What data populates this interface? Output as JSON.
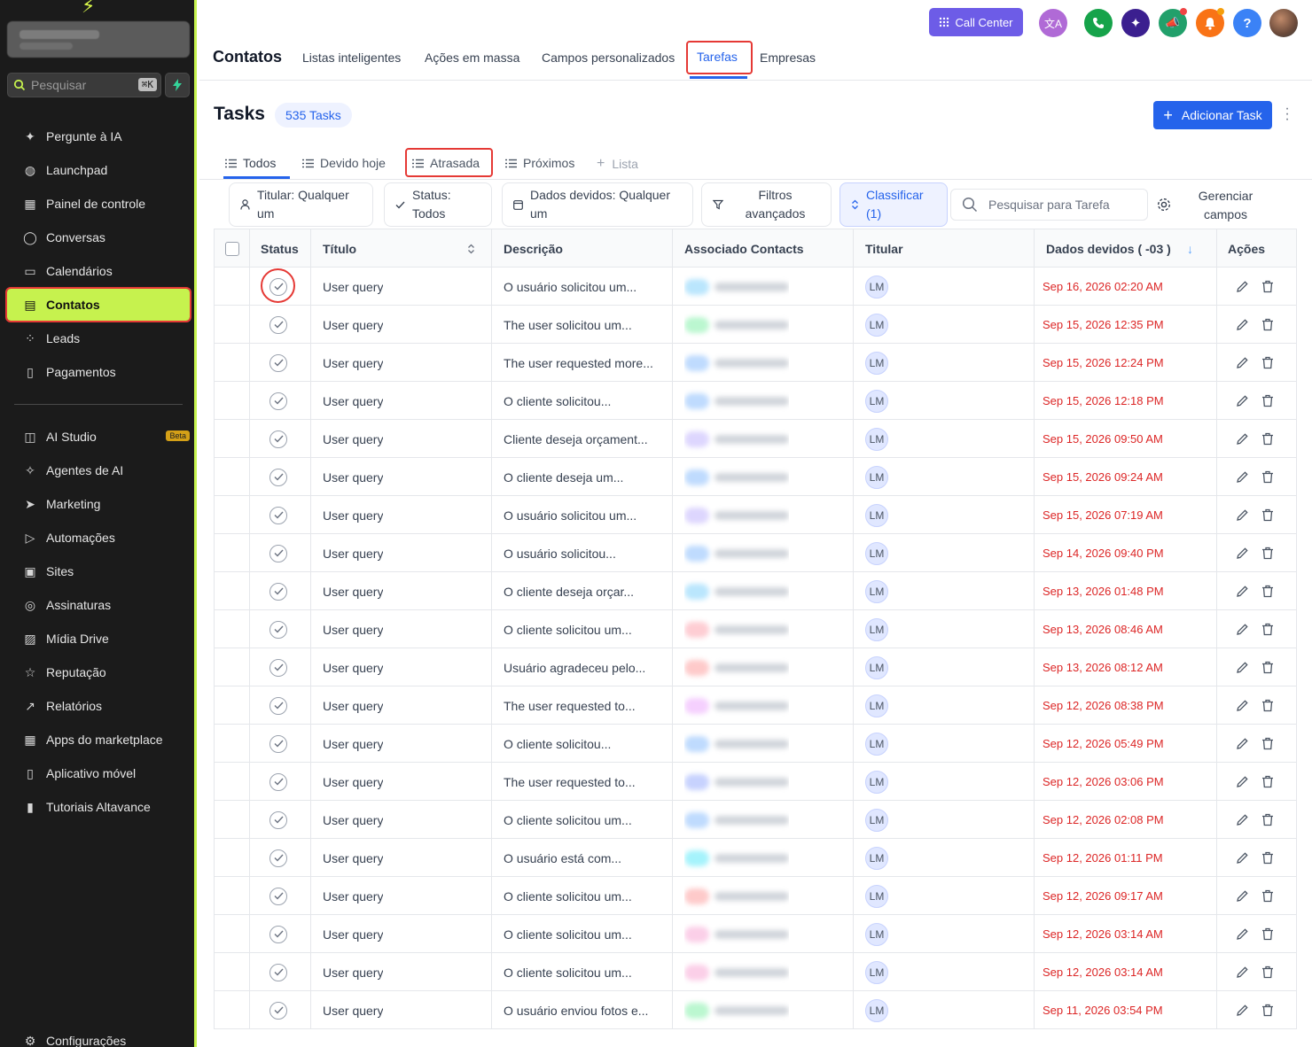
{
  "sidebar": {
    "search_placeholder": "Pesquisar",
    "search_shortcut": "⌘K",
    "items": [
      {
        "label": "Pergunte à IA",
        "icon": "sparkles-icon"
      },
      {
        "label": "Launchpad",
        "icon": "rocket-icon"
      },
      {
        "label": "Painel de controle",
        "icon": "dashboard-grid-icon"
      },
      {
        "label": "Conversas",
        "icon": "chat-bubble-icon"
      },
      {
        "label": "Calendários",
        "icon": "calendar-icon"
      },
      {
        "label": "Contatos",
        "icon": "contacts-card-icon",
        "active": true
      },
      {
        "label": "Leads",
        "icon": "leads-network-icon"
      },
      {
        "label": "Pagamentos",
        "icon": "receipt-icon"
      }
    ],
    "items2": [
      {
        "label": "AI Studio",
        "icon": "ai-studio-icon",
        "badge": "Beta"
      },
      {
        "label": "Agentes de AI",
        "icon": "ai-agent-icon"
      },
      {
        "label": "Marketing",
        "icon": "send-plane-icon"
      },
      {
        "label": "Automações",
        "icon": "automation-play-icon"
      },
      {
        "label": "Sites",
        "icon": "sites-window-icon"
      },
      {
        "label": "Assinaturas",
        "icon": "membership-badge-icon"
      },
      {
        "label": "Mídia Drive",
        "icon": "image-icon"
      },
      {
        "label": "Reputação",
        "icon": "star-icon"
      },
      {
        "label": "Relatórios",
        "icon": "trend-chart-icon"
      },
      {
        "label": "Apps do marketplace",
        "icon": "apps-grid-icon"
      },
      {
        "label": "Aplicativo móvel",
        "icon": "mobile-phone-icon"
      },
      {
        "label": "Tutoriais Altavance",
        "icon": "book-icon"
      }
    ],
    "settings_label": "Configurações"
  },
  "topbar": {
    "title": "Contatos",
    "tabs": [
      "Listas inteligentes",
      "Ações em massa",
      "Campos personalizados",
      "Tarefas",
      "Empresas"
    ],
    "active_tab": "Tarefas",
    "call_center_label": "Call Center"
  },
  "page": {
    "title": "Tasks",
    "count_label": "535 Tasks",
    "add_button": "Adicionar Task",
    "subtabs": [
      "Todos",
      "Devido hoje",
      "Atrasada",
      "Próximos",
      "Lista"
    ],
    "filters": {
      "owner_l1": "Titular: Qualquer",
      "owner_l2": "um",
      "status_l1": "Status:",
      "status_l2": "Todos",
      "due_l1": "Dados devidos: Qualquer",
      "due_l2": "um",
      "advanced_l1": "Filtros",
      "advanced_l2": "avançados",
      "sort_l1": "Classificar",
      "sort_l2": "(1)",
      "search_placeholder": "Pesquisar para Tarefa",
      "manage_l1": "Gerenciar",
      "manage_l2": "campos"
    }
  },
  "table": {
    "columns": {
      "status": "Status",
      "title": "Título",
      "description": "Descrição",
      "contacts": "Associado Contacts",
      "owner": "Titular",
      "due": "Dados devidos ( -03 )",
      "actions": "Ações"
    },
    "rows": [
      {
        "title": "User query",
        "desc": "O usuário solicitou um...",
        "owner": "LM",
        "due": "Sep 16, 2026 02:20 AM",
        "tint": "#bae6fd"
      },
      {
        "title": "User query",
        "desc": "The user solicitou um...",
        "owner": "LM",
        "due": "Sep 15, 2026 12:35 PM",
        "tint": "#bbf7d0"
      },
      {
        "title": "User query",
        "desc": "The user requested more...",
        "owner": "LM",
        "due": "Sep 15, 2026 12:24 PM",
        "tint": "#bfdbfe"
      },
      {
        "title": "User query",
        "desc": "O cliente solicitou...",
        "owner": "LM",
        "due": "Sep 15, 2026 12:18 PM",
        "tint": "#bfdbfe"
      },
      {
        "title": "User query",
        "desc": "Cliente deseja orçament...",
        "owner": "LM",
        "due": "Sep 15, 2026 09:50 AM",
        "tint": "#ddd6fe"
      },
      {
        "title": "User query",
        "desc": "O cliente deseja um...",
        "owner": "LM",
        "due": "Sep 15, 2026 09:24 AM",
        "tint": "#bfdbfe"
      },
      {
        "title": "User query",
        "desc": "O usuário solicitou um...",
        "owner": "LM",
        "due": "Sep 15, 2026 07:19 AM",
        "tint": "#ddd6fe"
      },
      {
        "title": "User query",
        "desc": "O usuário solicitou...",
        "owner": "LM",
        "due": "Sep 14, 2026 09:40 PM",
        "tint": "#bfdbfe"
      },
      {
        "title": "User query",
        "desc": "O cliente deseja orçar...",
        "owner": "LM",
        "due": "Sep 13, 2026 01:48 PM",
        "tint": "#bae6fd"
      },
      {
        "title": "User query",
        "desc": "O cliente solicitou um...",
        "owner": "LM",
        "due": "Sep 13, 2026 08:46 AM",
        "tint": "#fecdd3"
      },
      {
        "title": "User query",
        "desc": "Usuário agradeceu pelo...",
        "owner": "LM",
        "due": "Sep 13, 2026 08:12 AM",
        "tint": "#fecaca"
      },
      {
        "title": "User query",
        "desc": "The user requested to...",
        "owner": "LM",
        "due": "Sep 12, 2026 08:38 PM",
        "tint": "#f5d0fe"
      },
      {
        "title": "User query",
        "desc": "O cliente solicitou...",
        "owner": "LM",
        "due": "Sep 12, 2026 05:49 PM",
        "tint": "#bfdbfe"
      },
      {
        "title": "User query",
        "desc": "The user requested to...",
        "owner": "LM",
        "due": "Sep 12, 2026 03:06 PM",
        "tint": "#c7d2fe"
      },
      {
        "title": "User query",
        "desc": "O cliente solicitou um...",
        "owner": "LM",
        "due": "Sep 12, 2026 02:08 PM",
        "tint": "#bfdbfe"
      },
      {
        "title": "User query",
        "desc": "O usuário está com...",
        "owner": "LM",
        "due": "Sep 12, 2026 01:11 PM",
        "tint": "#a5f3fc"
      },
      {
        "title": "User query",
        "desc": "O cliente solicitou um...",
        "owner": "LM",
        "due": "Sep 12, 2026 09:17 AM",
        "tint": "#fecaca"
      },
      {
        "title": "User query",
        "desc": "O cliente solicitou um...",
        "owner": "LM",
        "due": "Sep 12, 2026 03:14 AM",
        "tint": "#fbcfe8"
      },
      {
        "title": "User query",
        "desc": "O cliente solicitou um...",
        "owner": "LM",
        "due": "Sep 12, 2026 03:14 AM",
        "tint": "#fbcfe8"
      },
      {
        "title": "User query",
        "desc": "O usuário enviou fotos e...",
        "owner": "LM",
        "due": "Sep 11, 2026 03:54 PM",
        "tint": "#bbf7d0"
      }
    ]
  },
  "colors": {
    "accent": "#2563eb",
    "sidebar_active": "#c6f24e",
    "due": "#dc2626",
    "highlight": "#e53935"
  }
}
